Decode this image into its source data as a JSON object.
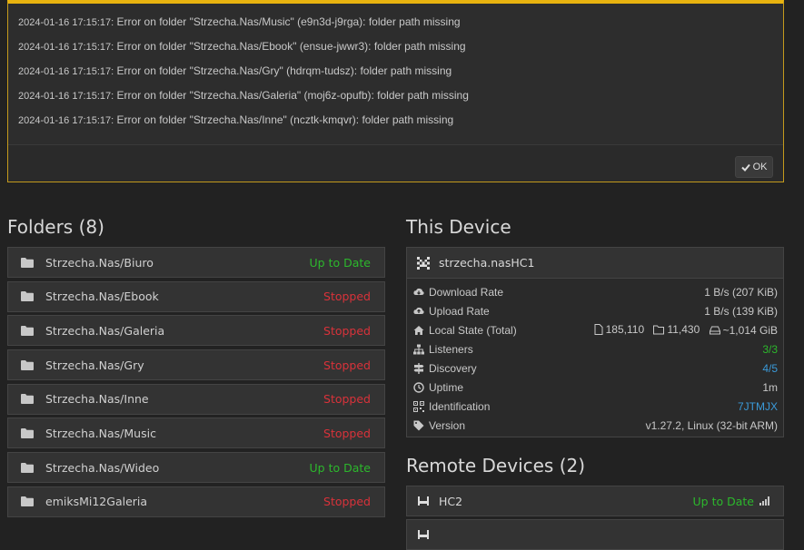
{
  "alert": {
    "lines": [
      {
        "ts": "2024-01-16 17:15:17:",
        "msg": " Error on folder \"Strzecha.Nas/Music\" (e9n3d-j9rga): folder path missing"
      },
      {
        "ts": "2024-01-16 17:15:17:",
        "msg": " Error on folder \"Strzecha.Nas/Ebook\" (ensue-jwwr3): folder path missing"
      },
      {
        "ts": "2024-01-16 17:15:17:",
        "msg": " Error on folder \"Strzecha.Nas/Gry\" (hdrqm-tudsz): folder path missing"
      },
      {
        "ts": "2024-01-16 17:15:17:",
        "msg": " Error on folder \"Strzecha.Nas/Galeria\" (moj6z-opufb): folder path missing"
      },
      {
        "ts": "2024-01-16 17:15:17:",
        "msg": " Error on folder \"Strzecha.Nas/Inne\" (ncztk-kmqvr): folder path missing"
      }
    ],
    "ok_label": "OK"
  },
  "folders": {
    "title": "Folders (8)",
    "items": [
      {
        "name": "Strzecha.Nas/Biuro",
        "status": "Up to Date",
        "color": "#2cb82c"
      },
      {
        "name": "Strzecha.Nas/Ebook",
        "status": "Stopped",
        "color": "#d9323a"
      },
      {
        "name": "Strzecha.Nas/Galeria",
        "status": "Stopped",
        "color": "#d9323a"
      },
      {
        "name": "Strzecha.Nas/Gry",
        "status": "Stopped",
        "color": "#d9323a"
      },
      {
        "name": "Strzecha.Nas/Inne",
        "status": "Stopped",
        "color": "#d9323a"
      },
      {
        "name": "Strzecha.Nas/Music",
        "status": "Stopped",
        "color": "#d9323a"
      },
      {
        "name": "Strzecha.Nas/Wideo",
        "status": "Up to Date",
        "color": "#2cb82c"
      },
      {
        "name": "emiksMi12Galeria",
        "status": "Stopped",
        "color": "#d9323a"
      }
    ]
  },
  "device": {
    "title": "This Device",
    "name": "strzecha.nasHC1",
    "download_label": "Download Rate",
    "download_value": "1 B/s (207 KiB)",
    "upload_label": "Upload Rate",
    "upload_value": "1 B/s (139 KiB)",
    "local_label": "Local State (Total)",
    "local_files": "185,110",
    "local_dirs": "11,430",
    "local_size": "~1,014 GiB",
    "listeners_label": "Listeners",
    "listeners_value": "3/3",
    "discovery_label": "Discovery",
    "discovery_value": "4/5",
    "uptime_label": "Uptime",
    "uptime_value": "1m",
    "ident_label": "Identification",
    "ident_value": "7JTMJX",
    "version_label": "Version",
    "version_value": "v1.27.2, Linux (32-bit ARM)"
  },
  "remote": {
    "title": "Remote Devices (2)",
    "items": [
      {
        "name": "HC2",
        "status": "Up to Date"
      }
    ]
  },
  "colors": {
    "green": "#2cb82c",
    "red": "#d9323a",
    "blue": "#3a9ad9",
    "warning": "#e8b30f"
  }
}
